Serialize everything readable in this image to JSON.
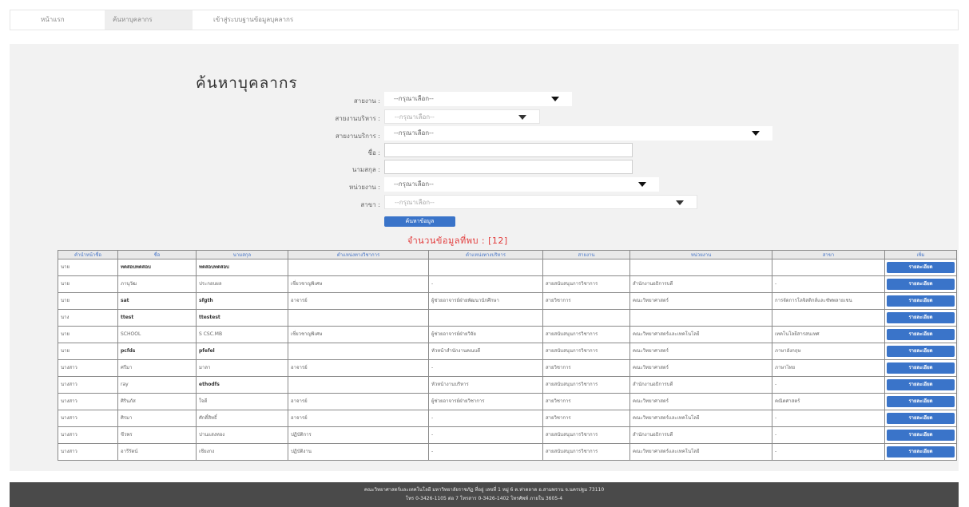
{
  "topnav": {
    "tabs": [
      {
        "label": "หน้าแรก",
        "active": false
      },
      {
        "label": "ค้นหาบุคลากร",
        "active": true
      },
      {
        "label": "เข้าสู่ระบบฐานข้อมูลบุคลากร",
        "active": false
      }
    ]
  },
  "search": {
    "heading": "ค้นหาบุคลากร",
    "fields": [
      {
        "label": "สายงาน :",
        "value": "--กรุณาเลือก--",
        "kind": "select"
      },
      {
        "label": "สายงานบริหาร :",
        "value": "--กรุณาเลือก--",
        "kind": "select-disabled"
      },
      {
        "label": "สายงานบริการ :",
        "value": "--กรุณาเลือก--",
        "kind": "select"
      },
      {
        "label": "ชื่อ :",
        "value": "",
        "kind": "text"
      },
      {
        "label": "นามสกุล :",
        "value": "",
        "kind": "text"
      },
      {
        "label": "หน่วยงาน :",
        "value": "--กรุณาเลือก--",
        "kind": "select"
      },
      {
        "label": "สาขา :",
        "value": "--กรุณาเลือก--",
        "kind": "select-disabled"
      }
    ],
    "button_label": "ค้นหาข้อมูล",
    "count_text": "จำนวนข้อมูลที่พบ : [12]"
  },
  "table": {
    "headers": [
      "คำนำหน้าชื่อ",
      "ชื่อ",
      "นามสกุล",
      "ตำแหน่งทางวิชาการ",
      "ตำแหน่งทางบริหาร",
      "สายงาน",
      "หน่วยงาน",
      "สาขา",
      "เพิ่ม"
    ],
    "detail_label": "รายละเอียด",
    "rows": [
      [
        "นาย",
        "ทดสอบทดสอบ",
        "ทดสอบทดสอบ",
        "",
        "",
        "",
        "",
        "",
        ""
      ],
      [
        "นาย",
        "ภานุวัฒ",
        "ประกอบผล",
        "เชี่ยวชาญพิเศษ",
        "-",
        "สายสนับสนุนการวิชาการ",
        "สำนักงานอธิการบดี",
        "-",
        ""
      ],
      [
        "นาย",
        "sat",
        "sfgth",
        "อาจารย์",
        "ผู้ช่วยอาจารย์ฝ่ายพัฒนานักศึกษา",
        "สายวิชาการ",
        "คณะวิทยาศาสตร์",
        "การจัดการโลจิสติกส์และซัพพลายเชน",
        ""
      ],
      [
        "นาง",
        "ttest",
        "ttestest",
        "",
        "",
        "",
        "",
        "",
        ""
      ],
      [
        "นาย",
        "SCHOOL",
        "S CSC.MB",
        "เชี่ยวชาญพิเศษ",
        "ผู้ช่วยอาจารย์ฝ่ายวิจัย",
        "สายสนับสนุนการวิชาการ",
        "คณะวิทยาศาสตร์และเทคโนโลยี",
        "เทคโนโลยีสารสนเทศ",
        ""
      ],
      [
        "นาย",
        "pcfds",
        "pfefel",
        "",
        "หัวหน้าสำนักงานคณบดี",
        "สายสนับสนุนการวิชาการ",
        "คณะวิทยาศาสตร์",
        "ภาษาอังกฤษ",
        ""
      ],
      [
        "นางสาว",
        "ศรีมา",
        "มาลา",
        "อาจารย์",
        "-",
        "สายวิชาการ",
        "คณะวิทยาศาสตร์",
        "ภาษาไทย",
        ""
      ],
      [
        "นางสาว",
        "ray",
        "ethodfs",
        "",
        "หัวหน้างานบริหาร",
        "สายสนับสนุนการวิชาการ",
        "สำนักงานอธิการบดี",
        "-",
        ""
      ],
      [
        "นางสาว",
        "ศิรินภัส",
        "ใจดี",
        "อาจารย์",
        "ผู้ช่วยอาจารย์ฝ่ายวิชาการ",
        "สายวิชาการ",
        "คณะวิทยาศาสตร์",
        "คณิตศาสตร์",
        ""
      ],
      [
        "นางสาว",
        "ศิรมา",
        "ศักดิ์สิทธิ์",
        "อาจารย์",
        "-",
        "สายวิชาการ",
        "คณะวิทยาศาสตร์และเทคโนโลยี",
        "-",
        ""
      ],
      [
        "นางสาว",
        "ชีวพร",
        "ปานแสงทอง",
        "ปฏิบัติการ",
        "-",
        "สายสนับสนุนการวิชาการ",
        "สำนักงานอธิการบดี",
        "-",
        ""
      ],
      [
        "นางสาว",
        "อารีรัตน์",
        "เชียงกง",
        "ปฏิบัติงาน",
        "-",
        "สายสนับสนุนการวิชาการ",
        "คณะวิทยาศาสตร์และเทคโนโลยี",
        "-",
        ""
      ]
    ]
  },
  "footer": {
    "line1": "คณะวิทยาศาสตร์และเทคโนโลยี มหาวิทยาลัยราชภัฏ ที่อยู่ เลขที่ 1 หมู่ 6 ต.ท่าตลาด อ.สามพราน จ.นครปฐม 73110",
    "line2": "โทร 0-3426-1105 ต่อ 7 โทรสาร 0-3426-1402 โทรศัพท์ ภายใน 3605-4"
  }
}
